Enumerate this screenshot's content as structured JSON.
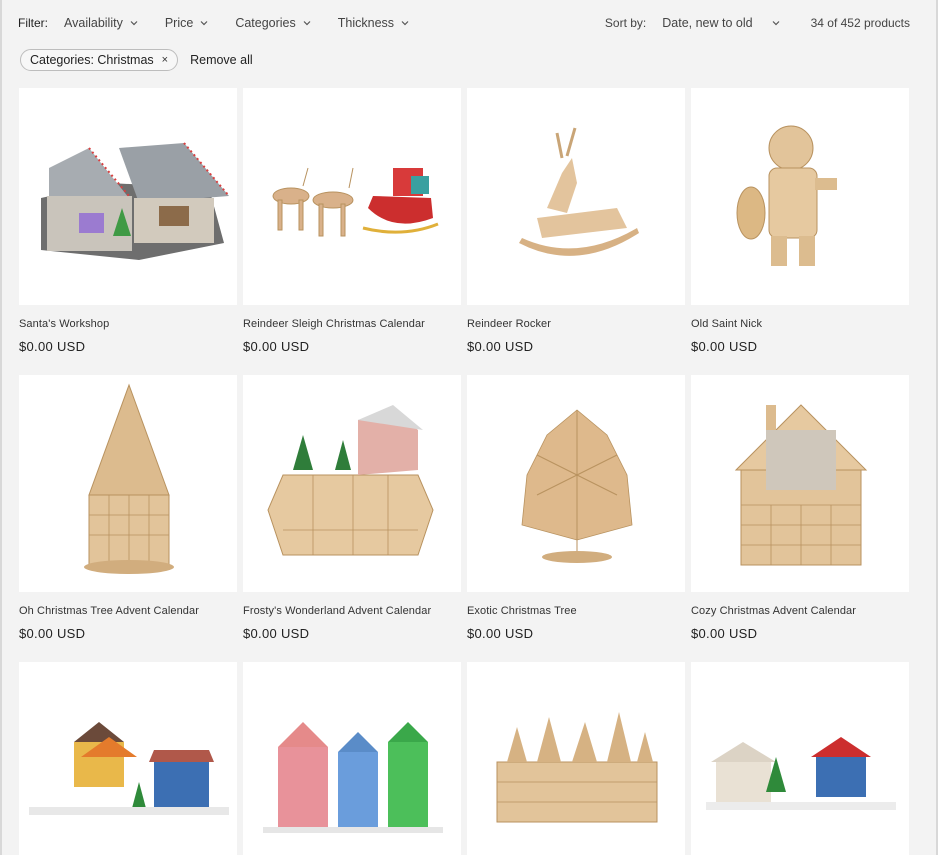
{
  "filters": {
    "label": "Filter:",
    "items": [
      "Availability",
      "Price",
      "Categories",
      "Thickness"
    ]
  },
  "sort": {
    "label": "Sort by:",
    "value": "Date, new to old"
  },
  "product_count": "34 of 452 products",
  "active_filters": {
    "chip_label": "Categories: Christmas",
    "chip_remove": "×",
    "remove_all": "Remove all"
  },
  "products": [
    {
      "title": "Santa's Workshop",
      "price": "$0.00 USD",
      "icon": "workshop-image"
    },
    {
      "title": "Reindeer Sleigh Christmas Calendar",
      "price": "$0.00 USD",
      "icon": "reindeer-sleigh-image"
    },
    {
      "title": "Reindeer Rocker",
      "price": "$0.00 USD",
      "icon": "reindeer-rocker-image"
    },
    {
      "title": "Old Saint Nick",
      "price": "$0.00 USD",
      "icon": "santa-figure-image"
    },
    {
      "title": "Oh Christmas Tree Advent Calendar",
      "price": "$0.00 USD",
      "icon": "tree-calendar-image"
    },
    {
      "title": "Frosty's Wonderland Advent Calendar",
      "price": "$0.00 USD",
      "icon": "wonderland-calendar-image"
    },
    {
      "title": "Exotic Christmas Tree",
      "price": "$0.00 USD",
      "icon": "exotic-tree-image"
    },
    {
      "title": "Cozy Christmas Advent Calendar",
      "price": "$0.00 USD",
      "icon": "cozy-calendar-image"
    },
    {
      "title": "",
      "price": "",
      "icon": "village-houses-image"
    },
    {
      "title": "",
      "price": "",
      "icon": "colorful-houses-image"
    },
    {
      "title": "",
      "price": "",
      "icon": "forest-calendar-image"
    },
    {
      "title": "",
      "price": "",
      "icon": "snow-village-image"
    }
  ],
  "colors": {
    "wood": "#e2c49a",
    "wood_dark": "#b8925f",
    "background": "#f3f3f3"
  }
}
